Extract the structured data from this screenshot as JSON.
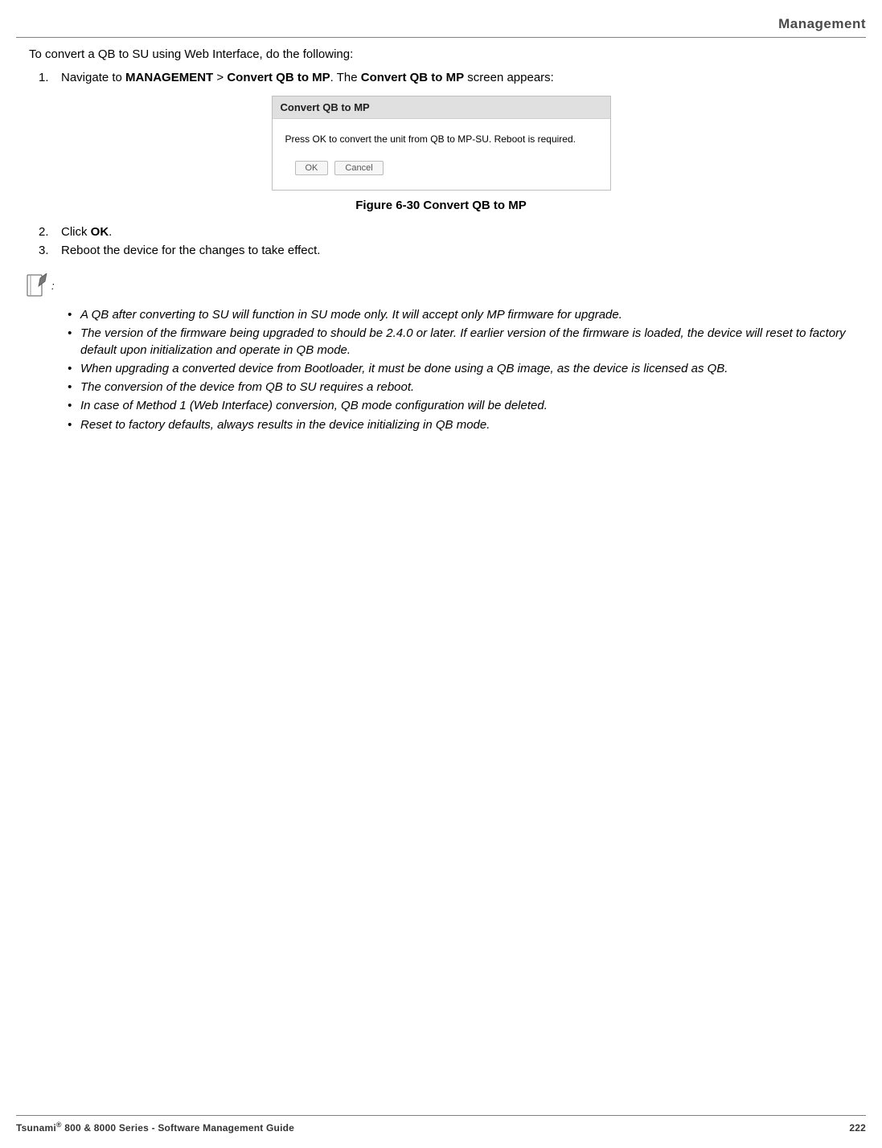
{
  "header": {
    "section_title": "Management"
  },
  "intro": "To convert a QB to SU using Web Interface, do the following:",
  "steps": {
    "s1": {
      "num": "1.",
      "prefix": "Navigate to ",
      "bold1": "MANAGEMENT",
      "sep": " > ",
      "bold2": "Convert QB to MP",
      "mid": ". The ",
      "bold3": "Convert QB to MP",
      "suffix": " screen appears:"
    },
    "s2": {
      "num": "2.",
      "prefix": "Click ",
      "bold1": "OK",
      "suffix": "."
    },
    "s3": {
      "num": "3.",
      "text": "Reboot the device for the changes to take effect."
    }
  },
  "dialog": {
    "title": "Convert QB to MP",
    "message": "Press OK to convert the unit from QB to MP-SU.  Reboot is required.",
    "ok_label": "OK",
    "cancel_label": "Cancel"
  },
  "figure_caption": "Figure 6-30 Convert QB to MP",
  "note_colon": ":",
  "notes": [
    "A QB after converting to SU will function in SU mode only. It will accept only MP firmware for upgrade.",
    "The version of the firmware being upgraded to should be 2.4.0 or later. If earlier version of the firmware is loaded, the device will reset to factory default upon initialization and operate in QB mode.",
    "When upgrading a converted device from Bootloader, it must be done using a QB image, as the device is licensed as QB.",
    "The conversion of the device from QB to SU requires a reboot.",
    "In case of Method 1 (Web Interface) conversion, QB mode configuration will be deleted.",
    "Reset to factory defaults, always results in the device initializing in QB mode."
  ],
  "footer": {
    "product": "Tsunami",
    "reg": "®",
    "rest": " 800 & 8000 Series - Software Management Guide",
    "page": "222"
  },
  "bullet": "•"
}
